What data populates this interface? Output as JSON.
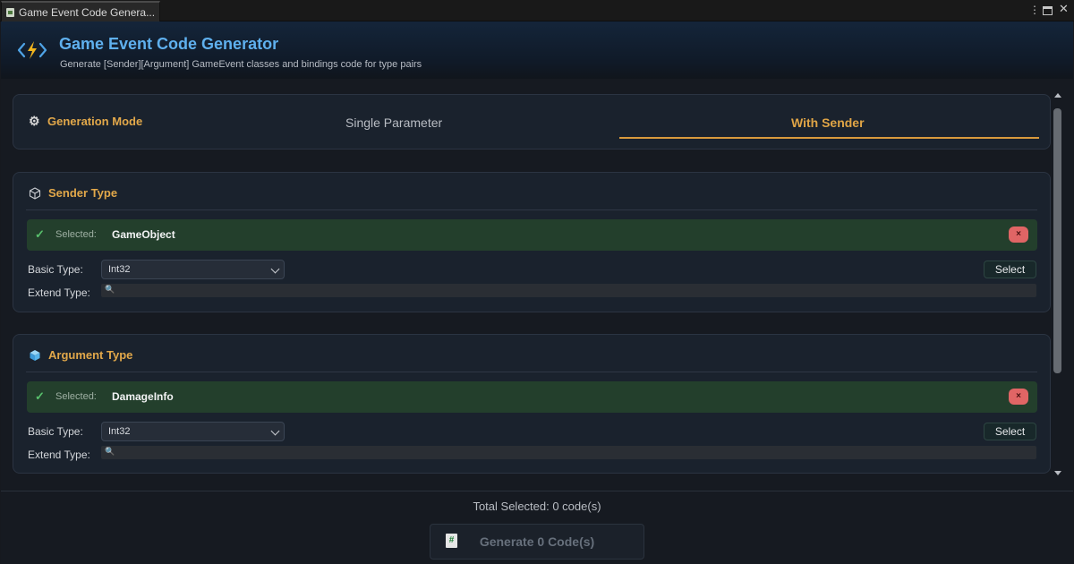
{
  "window": {
    "tab_title": "Game Event Code Genera...",
    "menu_glyph": "⋮",
    "close_glyph": "✕"
  },
  "header": {
    "title": "Game Event Code Generator",
    "subtitle": "Generate [Sender][Argument] GameEvent classes and bindings code for type pairs",
    "icon": "lightning-code-icon",
    "title_color": "#5fb0ee"
  },
  "generation_mode": {
    "label": "Generation Mode",
    "icon": "gear-icon",
    "tabs": [
      {
        "label": "Single Parameter",
        "active": false
      },
      {
        "label": "With Sender",
        "active": true
      }
    ],
    "accent_color": "#e2a84a"
  },
  "sender_type": {
    "title": "Sender Type",
    "icon": "cube-outline-icon",
    "selected_key": "Selected:",
    "selected_value": "GameObject",
    "remove_glyph": "×",
    "basic_type_label": "Basic Type:",
    "basic_type_value": "Int32",
    "select_label": "Select",
    "extend_type_label": "Extend Type:",
    "search_glyph": "🔍"
  },
  "argument_type": {
    "title": "Argument Type",
    "icon": "cube-filled-icon",
    "selected_key": "Selected:",
    "selected_value": "DamageInfo",
    "remove_glyph": "×",
    "basic_type_label": "Basic Type:",
    "basic_type_value": "Int32",
    "select_label": "Select",
    "extend_type_label": "Extend Type:",
    "search_glyph": "🔍"
  },
  "footer": {
    "total_selected": "Total Selected: 0 code(s)",
    "generate_label": "Generate 0 Code(s)",
    "generate_icon": "file-code-icon",
    "file_glyph": "#"
  },
  "colors": {
    "selected_row_bg": "#233f2c",
    "remove_button": "#e06565",
    "success_check": "#58c06c"
  }
}
